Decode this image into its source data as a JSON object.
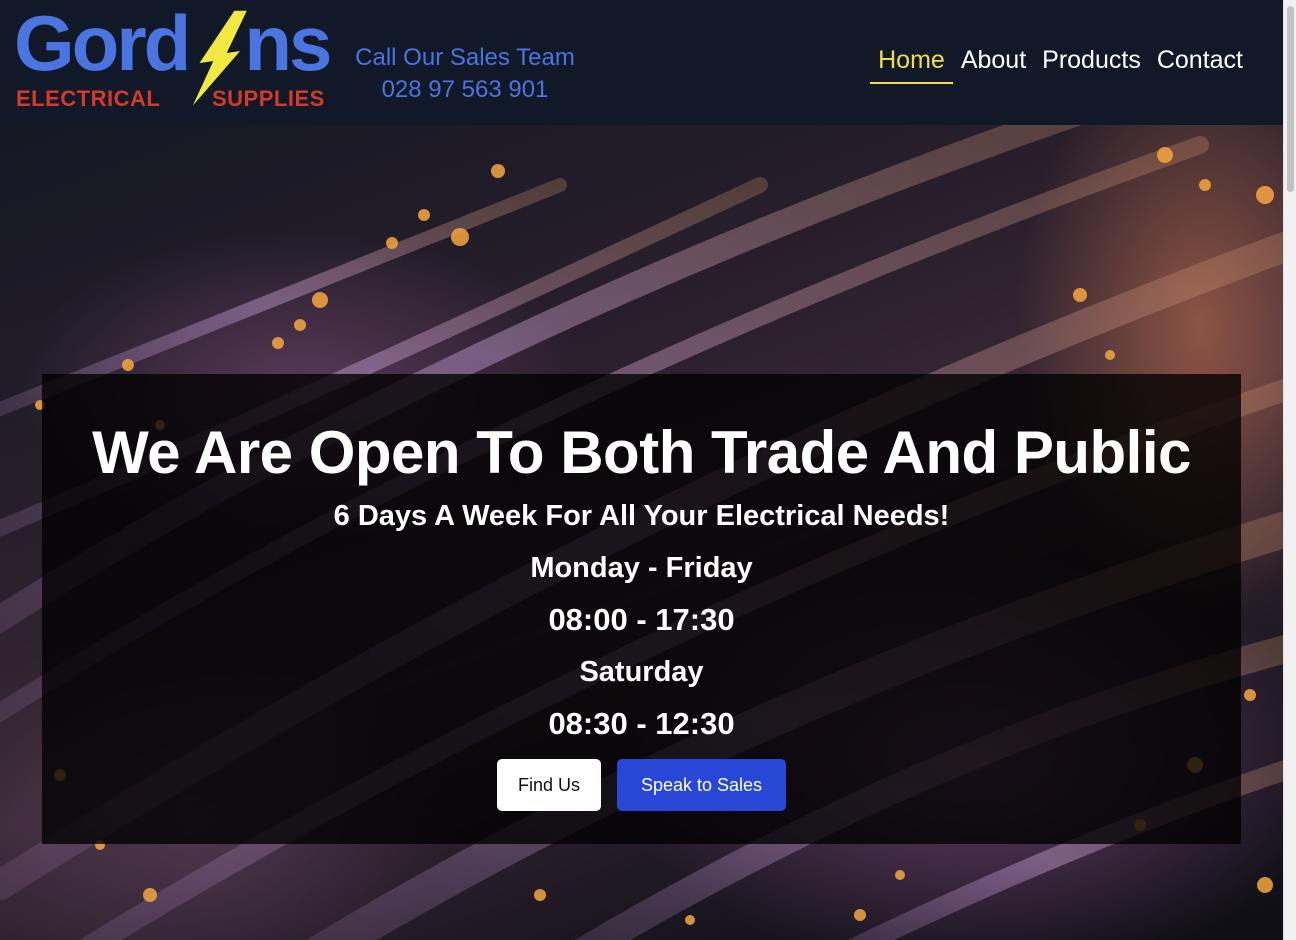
{
  "header": {
    "logo": {
      "word": "Gordons",
      "word_left": "Gord",
      "word_right": "ns",
      "sub_left": "ELECTRICAL",
      "sub_right": "SUPPLIES"
    },
    "sales": {
      "label": "Call Our Sales Team",
      "phone": "028 97 563 901"
    },
    "nav": {
      "items": [
        {
          "label": "Home",
          "active": true
        },
        {
          "label": "About",
          "active": false
        },
        {
          "label": "Products",
          "active": false
        },
        {
          "label": "Contact",
          "active": false
        }
      ]
    }
  },
  "hero": {
    "headline": "We Are Open To Both Trade And Public",
    "subline": "6 Days A Week For All Your Electrical Needs!",
    "hours": [
      "Monday - Friday",
      "08:00 - 17:30",
      "Saturday",
      "08:30 - 12:30"
    ],
    "buttons": {
      "find_us": "Find Us",
      "speak_to_sales": "Speak to Sales"
    }
  },
  "colors": {
    "header_bg": "#111827",
    "brand_blue": "#4a74e0",
    "brand_red": "#d33a2a",
    "bolt_yellow": "#f2e843",
    "nav_active": "#f2de4a",
    "cta_blue": "#2847d6"
  },
  "icons": {
    "bolt": "lightning-bolt-icon"
  }
}
